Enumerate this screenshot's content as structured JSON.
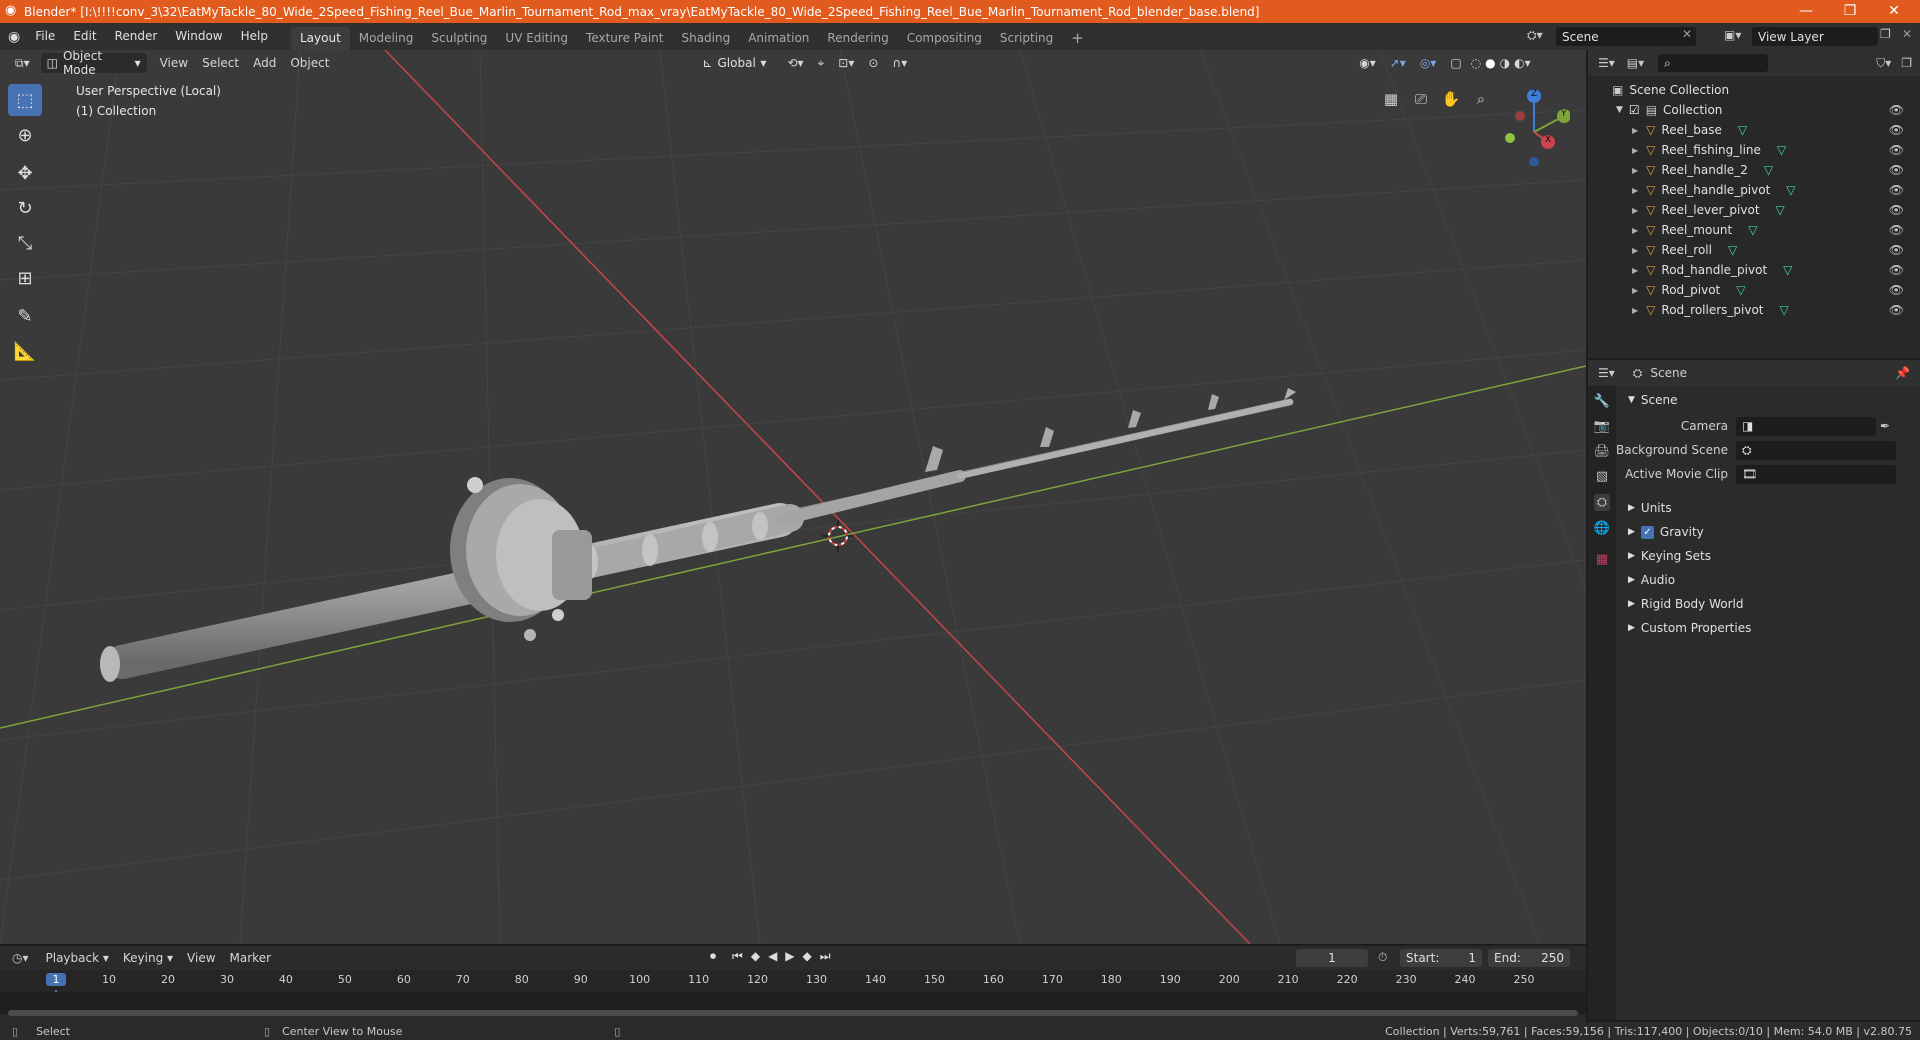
{
  "window": {
    "title": "Blender* [I:\\!!!!conv_3\\32\\EatMyTackle_80_Wide_2Speed_Fishing_Reel_Bue_Marlin_Tournament_Rod_max_vray\\EatMyTackle_80_Wide_2Speed_Fishing_Reel_Bue_Marlin_Tournament_Rod_blender_base.blend]"
  },
  "menu": [
    "File",
    "Edit",
    "Render",
    "Window",
    "Help"
  ],
  "workspaces": [
    "Layout",
    "Modeling",
    "Sculpting",
    "UV Editing",
    "Texture Paint",
    "Shading",
    "Animation",
    "Rendering",
    "Compositing",
    "Scripting"
  ],
  "active_workspace": "Layout",
  "scene_field": "Scene",
  "view_layer_field": "View Layer",
  "viewport": {
    "mode": "Object Mode",
    "menus": [
      "View",
      "Select",
      "Add",
      "Object"
    ],
    "transform_orientation": "Global",
    "overlay_line1": "User Perspective (Local)",
    "overlay_line2": "(1) Collection",
    "gizmo_axes": {
      "z": "Z",
      "y": "Y",
      "x": "X"
    }
  },
  "outliner": {
    "root": "Scene Collection",
    "collection": "Collection",
    "objects": [
      "Reel_base",
      "Reel_fishing_line",
      "Reel_handle_2",
      "Reel_handle_pivot",
      "Reel_lever_pivot",
      "Reel_mount",
      "Reel_roll",
      "Rod_handle_pivot",
      "Rod_pivot",
      "Rod_rollers_pivot"
    ]
  },
  "properties": {
    "context": "Scene",
    "section": "Scene",
    "camera_label": "Camera",
    "background_scene_label": "Background Scene",
    "active_movie_clip_label": "Active Movie Clip",
    "subsections": [
      "Units",
      "Gravity",
      "Keying Sets",
      "Audio",
      "Rigid Body World",
      "Custom Properties"
    ],
    "gravity_checked": true
  },
  "timeline": {
    "menus": [
      "Playback",
      "Keying",
      "View",
      "Marker"
    ],
    "current_frame": "1",
    "start_label": "Start:",
    "start_value": "1",
    "end_label": "End:",
    "end_value": "250",
    "ticks": [
      "1",
      "10",
      "20",
      "30",
      "40",
      "50",
      "60",
      "70",
      "80",
      "90",
      "100",
      "110",
      "120",
      "130",
      "140",
      "150",
      "160",
      "170",
      "180",
      "190",
      "200",
      "210",
      "220",
      "230",
      "240",
      "250"
    ]
  },
  "status": {
    "left_action": "Select",
    "middle_action": "Center View to Mouse",
    "stats": "Collection | Verts:59,761 | Faces:59,156 | Tris:117,400 | Objects:0/10 | Mem: 54.0 MB | v2.80.75"
  },
  "colors": {
    "titlebar": "#e15a1e",
    "accent": "#4772b3",
    "x_axis": "#c9444b",
    "y_axis": "#7ea33a",
    "z_axis": "#3f7ed9",
    "mesh_icon": "#e59a3c",
    "data_icon": "#3fd9a8"
  }
}
